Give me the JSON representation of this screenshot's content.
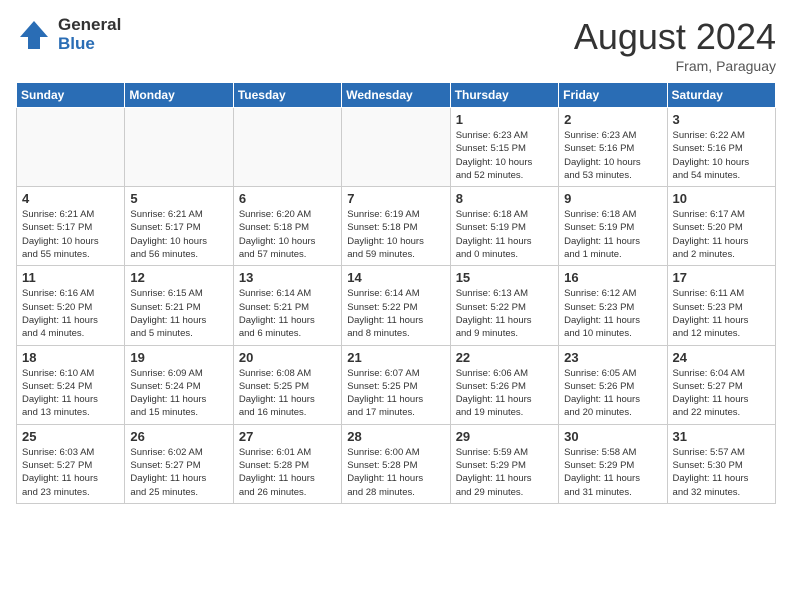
{
  "logo": {
    "general": "General",
    "blue": "Blue"
  },
  "title": {
    "month_year": "August 2024",
    "location": "Fram, Paraguay"
  },
  "weekdays": [
    "Sunday",
    "Monday",
    "Tuesday",
    "Wednesday",
    "Thursday",
    "Friday",
    "Saturday"
  ],
  "weeks": [
    [
      {
        "day": "",
        "info": ""
      },
      {
        "day": "",
        "info": ""
      },
      {
        "day": "",
        "info": ""
      },
      {
        "day": "",
        "info": ""
      },
      {
        "day": "1",
        "info": "Sunrise: 6:23 AM\nSunset: 5:15 PM\nDaylight: 10 hours\nand 52 minutes."
      },
      {
        "day": "2",
        "info": "Sunrise: 6:23 AM\nSunset: 5:16 PM\nDaylight: 10 hours\nand 53 minutes."
      },
      {
        "day": "3",
        "info": "Sunrise: 6:22 AM\nSunset: 5:16 PM\nDaylight: 10 hours\nand 54 minutes."
      }
    ],
    [
      {
        "day": "4",
        "info": "Sunrise: 6:21 AM\nSunset: 5:17 PM\nDaylight: 10 hours\nand 55 minutes."
      },
      {
        "day": "5",
        "info": "Sunrise: 6:21 AM\nSunset: 5:17 PM\nDaylight: 10 hours\nand 56 minutes."
      },
      {
        "day": "6",
        "info": "Sunrise: 6:20 AM\nSunset: 5:18 PM\nDaylight: 10 hours\nand 57 minutes."
      },
      {
        "day": "7",
        "info": "Sunrise: 6:19 AM\nSunset: 5:18 PM\nDaylight: 10 hours\nand 59 minutes."
      },
      {
        "day": "8",
        "info": "Sunrise: 6:18 AM\nSunset: 5:19 PM\nDaylight: 11 hours\nand 0 minutes."
      },
      {
        "day": "9",
        "info": "Sunrise: 6:18 AM\nSunset: 5:19 PM\nDaylight: 11 hours\nand 1 minute."
      },
      {
        "day": "10",
        "info": "Sunrise: 6:17 AM\nSunset: 5:20 PM\nDaylight: 11 hours\nand 2 minutes."
      }
    ],
    [
      {
        "day": "11",
        "info": "Sunrise: 6:16 AM\nSunset: 5:20 PM\nDaylight: 11 hours\nand 4 minutes."
      },
      {
        "day": "12",
        "info": "Sunrise: 6:15 AM\nSunset: 5:21 PM\nDaylight: 11 hours\nand 5 minutes."
      },
      {
        "day": "13",
        "info": "Sunrise: 6:14 AM\nSunset: 5:21 PM\nDaylight: 11 hours\nand 6 minutes."
      },
      {
        "day": "14",
        "info": "Sunrise: 6:14 AM\nSunset: 5:22 PM\nDaylight: 11 hours\nand 8 minutes."
      },
      {
        "day": "15",
        "info": "Sunrise: 6:13 AM\nSunset: 5:22 PM\nDaylight: 11 hours\nand 9 minutes."
      },
      {
        "day": "16",
        "info": "Sunrise: 6:12 AM\nSunset: 5:23 PM\nDaylight: 11 hours\nand 10 minutes."
      },
      {
        "day": "17",
        "info": "Sunrise: 6:11 AM\nSunset: 5:23 PM\nDaylight: 11 hours\nand 12 minutes."
      }
    ],
    [
      {
        "day": "18",
        "info": "Sunrise: 6:10 AM\nSunset: 5:24 PM\nDaylight: 11 hours\nand 13 minutes."
      },
      {
        "day": "19",
        "info": "Sunrise: 6:09 AM\nSunset: 5:24 PM\nDaylight: 11 hours\nand 15 minutes."
      },
      {
        "day": "20",
        "info": "Sunrise: 6:08 AM\nSunset: 5:25 PM\nDaylight: 11 hours\nand 16 minutes."
      },
      {
        "day": "21",
        "info": "Sunrise: 6:07 AM\nSunset: 5:25 PM\nDaylight: 11 hours\nand 17 minutes."
      },
      {
        "day": "22",
        "info": "Sunrise: 6:06 AM\nSunset: 5:26 PM\nDaylight: 11 hours\nand 19 minutes."
      },
      {
        "day": "23",
        "info": "Sunrise: 6:05 AM\nSunset: 5:26 PM\nDaylight: 11 hours\nand 20 minutes."
      },
      {
        "day": "24",
        "info": "Sunrise: 6:04 AM\nSunset: 5:27 PM\nDaylight: 11 hours\nand 22 minutes."
      }
    ],
    [
      {
        "day": "25",
        "info": "Sunrise: 6:03 AM\nSunset: 5:27 PM\nDaylight: 11 hours\nand 23 minutes."
      },
      {
        "day": "26",
        "info": "Sunrise: 6:02 AM\nSunset: 5:27 PM\nDaylight: 11 hours\nand 25 minutes."
      },
      {
        "day": "27",
        "info": "Sunrise: 6:01 AM\nSunset: 5:28 PM\nDaylight: 11 hours\nand 26 minutes."
      },
      {
        "day": "28",
        "info": "Sunrise: 6:00 AM\nSunset: 5:28 PM\nDaylight: 11 hours\nand 28 minutes."
      },
      {
        "day": "29",
        "info": "Sunrise: 5:59 AM\nSunset: 5:29 PM\nDaylight: 11 hours\nand 29 minutes."
      },
      {
        "day": "30",
        "info": "Sunrise: 5:58 AM\nSunset: 5:29 PM\nDaylight: 11 hours\nand 31 minutes."
      },
      {
        "day": "31",
        "info": "Sunrise: 5:57 AM\nSunset: 5:30 PM\nDaylight: 11 hours\nand 32 minutes."
      }
    ]
  ]
}
